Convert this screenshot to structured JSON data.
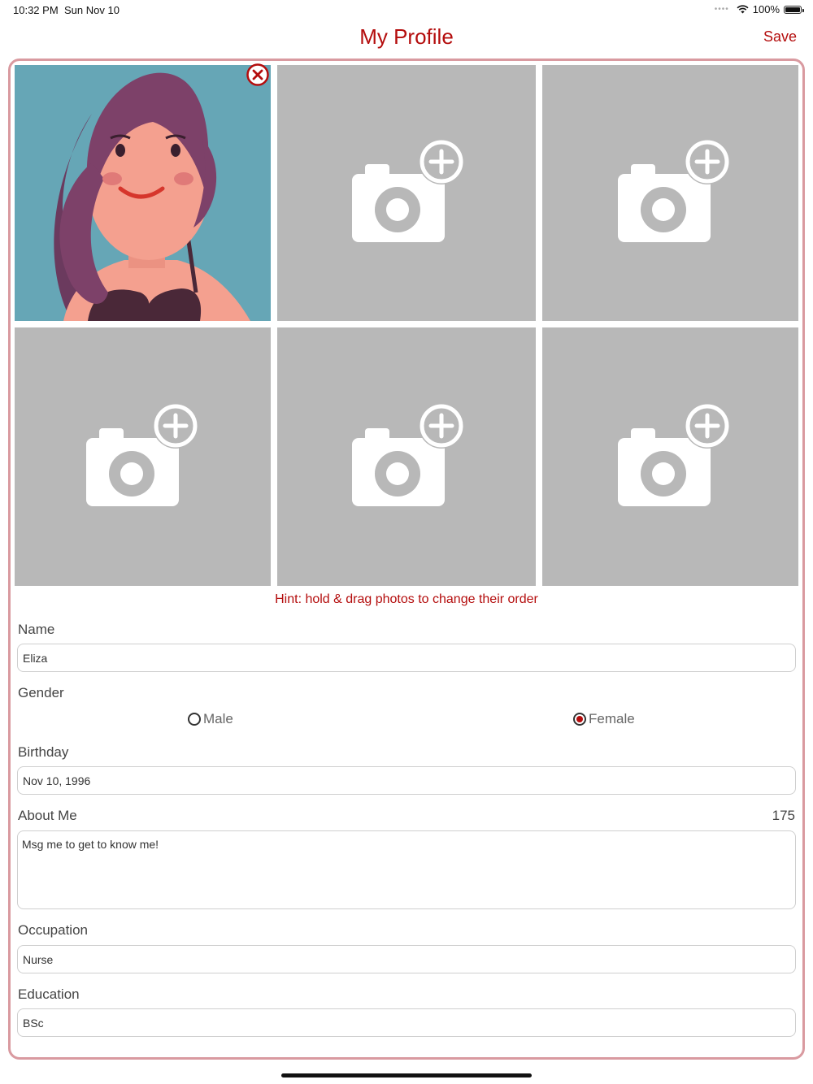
{
  "status_bar": {
    "time": "10:32 PM",
    "date": "Sun Nov 10",
    "battery": "100%",
    "battery_level": 1.0
  },
  "header": {
    "title": "My Profile",
    "save_label": "Save"
  },
  "photos": {
    "slots": [
      {
        "state": "filled",
        "icon": "avatar-photo"
      },
      {
        "state": "empty",
        "icon": "add-photo-icon"
      },
      {
        "state": "empty",
        "icon": "add-photo-icon"
      },
      {
        "state": "empty",
        "icon": "add-photo-icon"
      },
      {
        "state": "empty",
        "icon": "add-photo-icon"
      },
      {
        "state": "empty",
        "icon": "add-photo-icon"
      }
    ],
    "hint": "Hint: hold & drag photos to change their order"
  },
  "form": {
    "name": {
      "label": "Name",
      "value": "Eliza"
    },
    "gender": {
      "label": "Gender",
      "options": [
        "Male",
        "Female"
      ],
      "selected": "Female"
    },
    "birthday": {
      "label": "Birthday",
      "value": "Nov 10, 1996"
    },
    "about": {
      "label": "About Me",
      "value": "Msg me to get to know me!",
      "remaining": "175"
    },
    "occupation": {
      "label": "Occupation",
      "value": "Nurse"
    },
    "education": {
      "label": "Education",
      "value": "BSc"
    }
  },
  "colors": {
    "accent": "#b40d0d",
    "panel_border": "#d99aa0",
    "photo_placeholder": "#b8b8b8",
    "photo_bg": "#66a6b6"
  }
}
